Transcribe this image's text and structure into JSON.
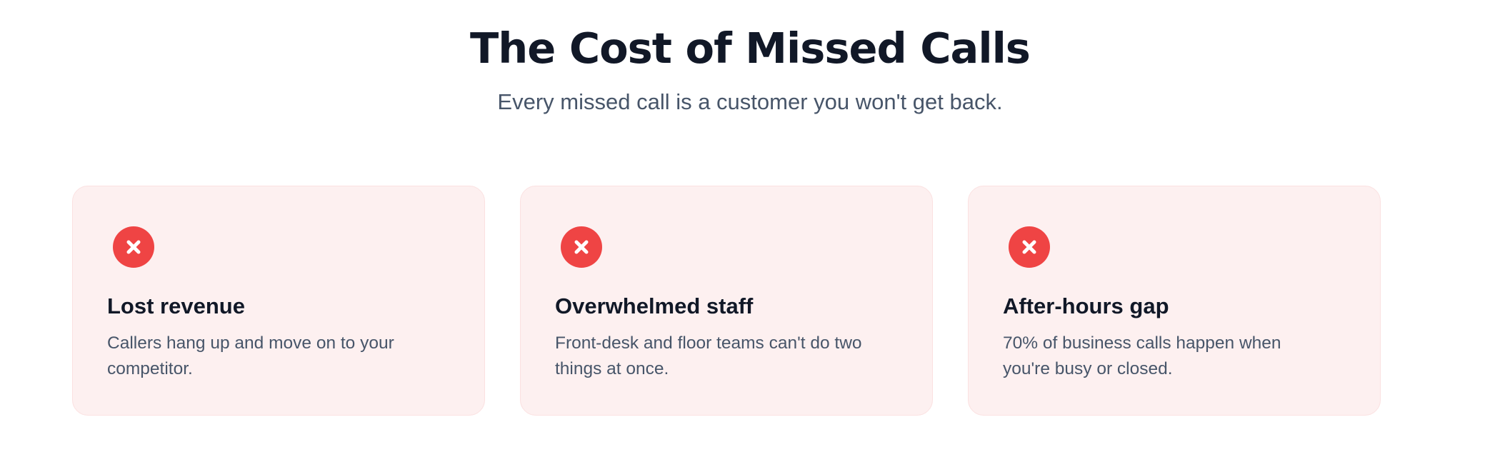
{
  "header": {
    "title": "The Cost of Missed Calls",
    "subtitle": "Every missed call is a customer you won't get back."
  },
  "colors": {
    "accent": "#ef4444",
    "card_background": "#fdf0f0",
    "heading": "#111827",
    "muted_text": "#475569"
  },
  "cards": [
    {
      "icon": "x-circle-icon",
      "title": "Lost revenue",
      "body": "Callers hang up and move on to your competitor."
    },
    {
      "icon": "x-circle-icon",
      "title": "Overwhelmed staff",
      "body": "Front-desk and floor teams can't do two things at once."
    },
    {
      "icon": "x-circle-icon",
      "title": "After-hours gap",
      "body": "70% of business calls happen when you're busy or closed."
    }
  ]
}
